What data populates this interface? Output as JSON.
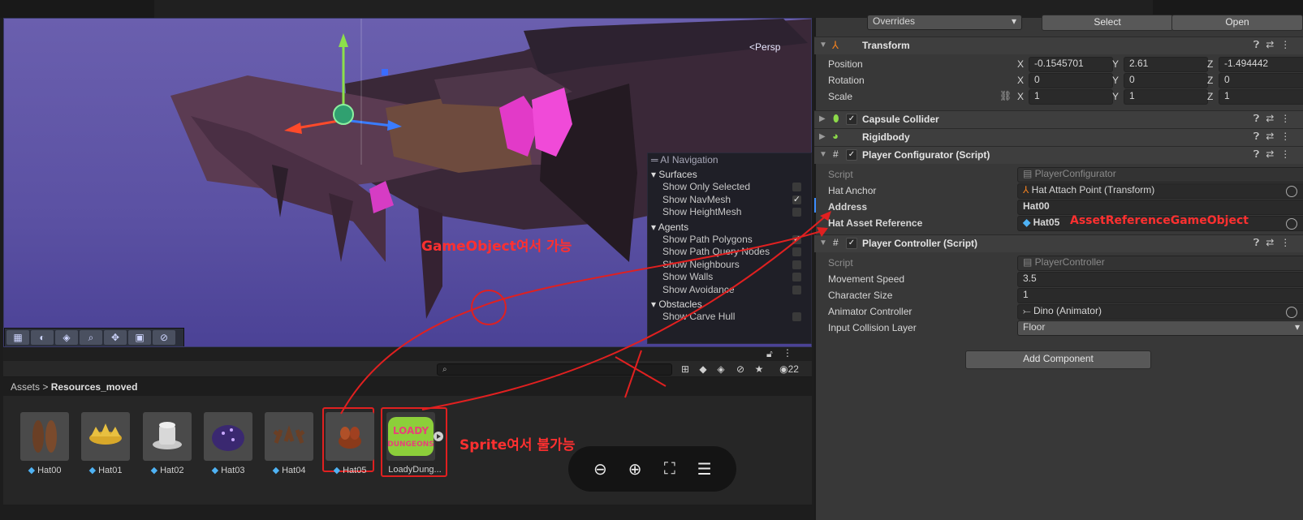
{
  "scene": {
    "camera_mode": "Persp",
    "toolbar_icons": [
      "grid-icon",
      "shading-icon",
      "layers-icon",
      "search-icon",
      "move-icon",
      "camera-icon",
      "gizmo-icon"
    ]
  },
  "ai_navigation": {
    "title": "AI Navigation",
    "sections": [
      {
        "name": "Surfaces",
        "items": [
          {
            "label": "Show Only Selected",
            "checked": false
          },
          {
            "label": "Show NavMesh",
            "checked": true
          },
          {
            "label": "Show HeightMesh",
            "checked": false
          }
        ]
      },
      {
        "name": "Agents",
        "items": [
          {
            "label": "Show Path Polygons",
            "checked": true
          },
          {
            "label": "Show Path Query Nodes",
            "checked": false
          },
          {
            "label": "Show Neighbours",
            "checked": false
          },
          {
            "label": "Show Walls",
            "checked": false
          },
          {
            "label": "Show Avoidance",
            "checked": false
          }
        ]
      },
      {
        "name": "Obstacles",
        "items": [
          {
            "label": "Show Carve Hull",
            "checked": false
          }
        ]
      }
    ]
  },
  "project": {
    "breadcrumb_root": "Assets",
    "breadcrumb_sep": ">",
    "breadcrumb_current": "Resources_moved",
    "visible_count": "22",
    "assets": [
      {
        "label": "Hat00",
        "icon": "bunny-ears-icon"
      },
      {
        "label": "Hat01",
        "icon": "crown-icon"
      },
      {
        "label": "Hat02",
        "icon": "top-hat-icon"
      },
      {
        "label": "Hat03",
        "icon": "beanie-icon"
      },
      {
        "label": "Hat04",
        "icon": "antlers-icon"
      },
      {
        "label": "Hat05",
        "icon": "leaf-hat-icon"
      },
      {
        "label": "LoadyDung...",
        "icon": "loady-dungeons-logo",
        "logo_text": "LOADY DUNGEONS"
      }
    ]
  },
  "zoom_controls": [
    "zoom-out-icon",
    "zoom-in-icon",
    "fit-screen-icon",
    "notes-icon"
  ],
  "inspector": {
    "overrides": "Overrides",
    "select_button": "Select",
    "open_button": "Open",
    "transform": {
      "title": "Transform",
      "position_label": "Position",
      "rotation_label": "Rotation",
      "scale_label": "Scale",
      "position": {
        "x": "-0.1545701",
        "y": "2.61",
        "z": "-1.494442"
      },
      "rotation": {
        "x": "0",
        "y": "0",
        "z": "0"
      },
      "scale": {
        "x": "1",
        "y": "1",
        "z": "1"
      }
    },
    "capsule_collider": "Capsule Collider",
    "rigidbody": "Rigidbody",
    "player_configurator": {
      "title": "Player Configurator (Script)",
      "script_label": "Script",
      "script_value": "PlayerConfigurator",
      "hat_anchor_label": "Hat Anchor",
      "hat_anchor_value": "Hat Attach Point (Transform)",
      "address_label": "Address",
      "address_value": "Hat00",
      "hat_asset_label": "Hat Asset Reference",
      "hat_asset_value": "Hat05"
    },
    "player_controller": {
      "title": "Player Controller (Script)",
      "script_label": "Script",
      "script_value": "PlayerController",
      "movement_speed_label": "Movement Speed",
      "movement_speed_value": "3.5",
      "character_size_label": "Character Size",
      "character_size_value": "1",
      "animator_label": "Animator Controller",
      "animator_value": "Dino (Animator)",
      "collision_label": "Input Collision Layer",
      "collision_value": "Floor"
    },
    "add_component": "Add Component"
  },
  "annotations": {
    "gameobject_ok": "GameObject여서 가능",
    "sprite_not_ok": "Sprite여서 불가능",
    "asset_ref_type": "AssetReferenceGameObject",
    "color": "#e02020"
  }
}
